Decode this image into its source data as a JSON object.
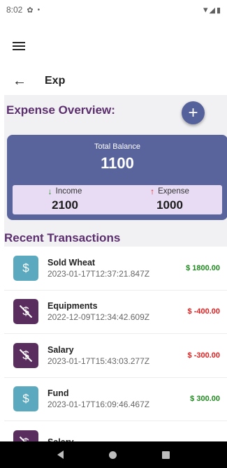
{
  "status_bar": {
    "time": "8:02",
    "gear_glyph": "✿",
    "dot": "•",
    "wifi_glyph": "▾",
    "signal_glyph": "◢",
    "battery_glyph": "▮"
  },
  "app_bar": {
    "menu_icon": "hamburger-icon"
  },
  "sub_header": {
    "back_glyph": "←",
    "title": "Exp"
  },
  "overview": {
    "title": "Expense Overview:",
    "add_glyph": "+",
    "total_balance_label": "Total Balance",
    "total_balance": "1100",
    "income_label": "Income",
    "income_value": "2100",
    "income_arrow": "↓",
    "expense_label": "Expense",
    "expense_value": "1000",
    "expense_arrow": "↑"
  },
  "recent": {
    "title": "Recent Transactions",
    "transactions": [
      {
        "name": "Sold Wheat",
        "date": "2023-01-17T12:37:21.847Z",
        "amount": "$ 1800.00",
        "type": "income"
      },
      {
        "name": "Equipments",
        "date": "2022-12-09T12:34:42.609Z",
        "amount": "$ -400.00",
        "type": "expense"
      },
      {
        "name": "Salary",
        "date": "2023-01-17T15:43:03.277Z",
        "amount": "$ -300.00",
        "type": "expense"
      },
      {
        "name": "Fund",
        "date": "2023-01-17T16:09:46.467Z",
        "amount": "$ 300.00",
        "type": "income"
      },
      {
        "name": "Salary",
        "date": "",
        "amount": "",
        "type": "expense"
      }
    ],
    "icon_glyph": "$"
  },
  "colors": {
    "income": "#1e8a1e",
    "expense": "#e02020",
    "accent": "#59649c",
    "title": "#5b2e6e"
  }
}
